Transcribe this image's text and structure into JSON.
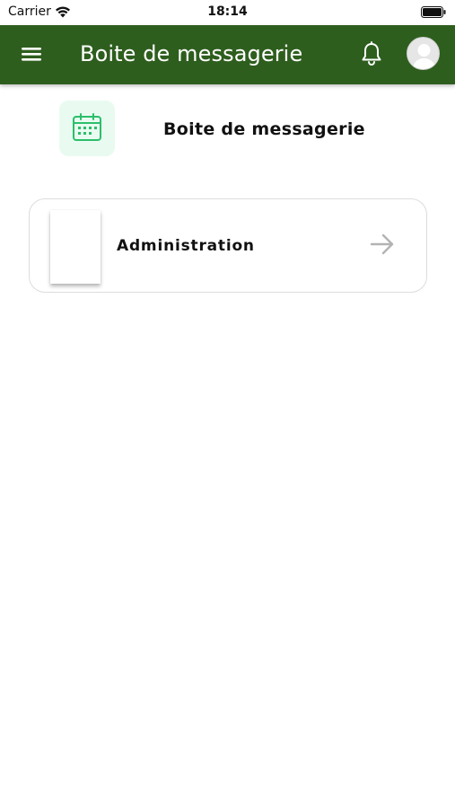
{
  "status_bar": {
    "carrier": "Carrier",
    "time": "18:14",
    "wifi_icon": "wifi-icon",
    "battery_icon": "battery-icon"
  },
  "app_bar": {
    "title": "Boite de messagerie",
    "background_color": "#2e5e1e",
    "menu_icon": "hamburger-menu-icon",
    "notification_icon": "bell-icon",
    "avatar_icon": "user-avatar-icon"
  },
  "header": {
    "icon": "calendar-icon",
    "icon_color": "#2bbf6a",
    "icon_background": "#e9fbf1",
    "title": "Boite de messagerie"
  },
  "list": {
    "items": [
      {
        "label": "Administration",
        "action_icon": "arrow-right-icon"
      }
    ]
  }
}
